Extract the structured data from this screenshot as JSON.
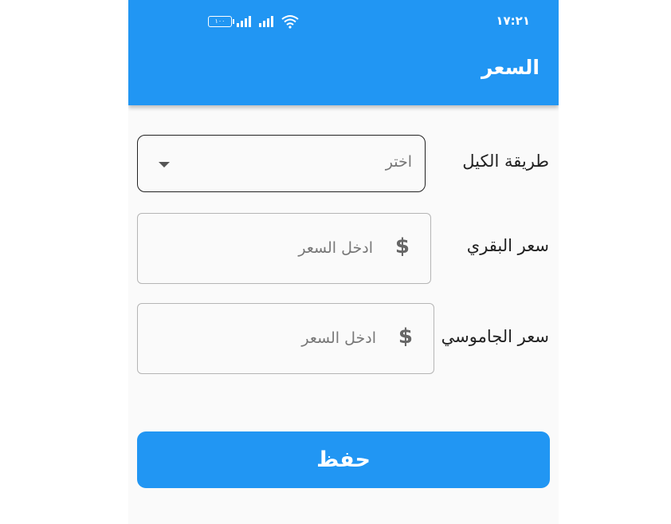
{
  "status_bar": {
    "time": "١٧:٢١",
    "battery": "١٠٠"
  },
  "app_bar": {
    "title": "السعر"
  },
  "form": {
    "measure_method": {
      "label": "طريقة الكيل",
      "selected": "اختر"
    },
    "cow_price": {
      "label": "سعر البقري",
      "placeholder": "ادخل السعر",
      "prefix": "$"
    },
    "buffalo_price": {
      "label": "سعر الجاموسي",
      "placeholder": "ادخل السعر",
      "prefix": "$"
    }
  },
  "save_button": {
    "label": "حفظ"
  },
  "colors": {
    "primary": "#2196f3",
    "background": "#fafafa"
  }
}
